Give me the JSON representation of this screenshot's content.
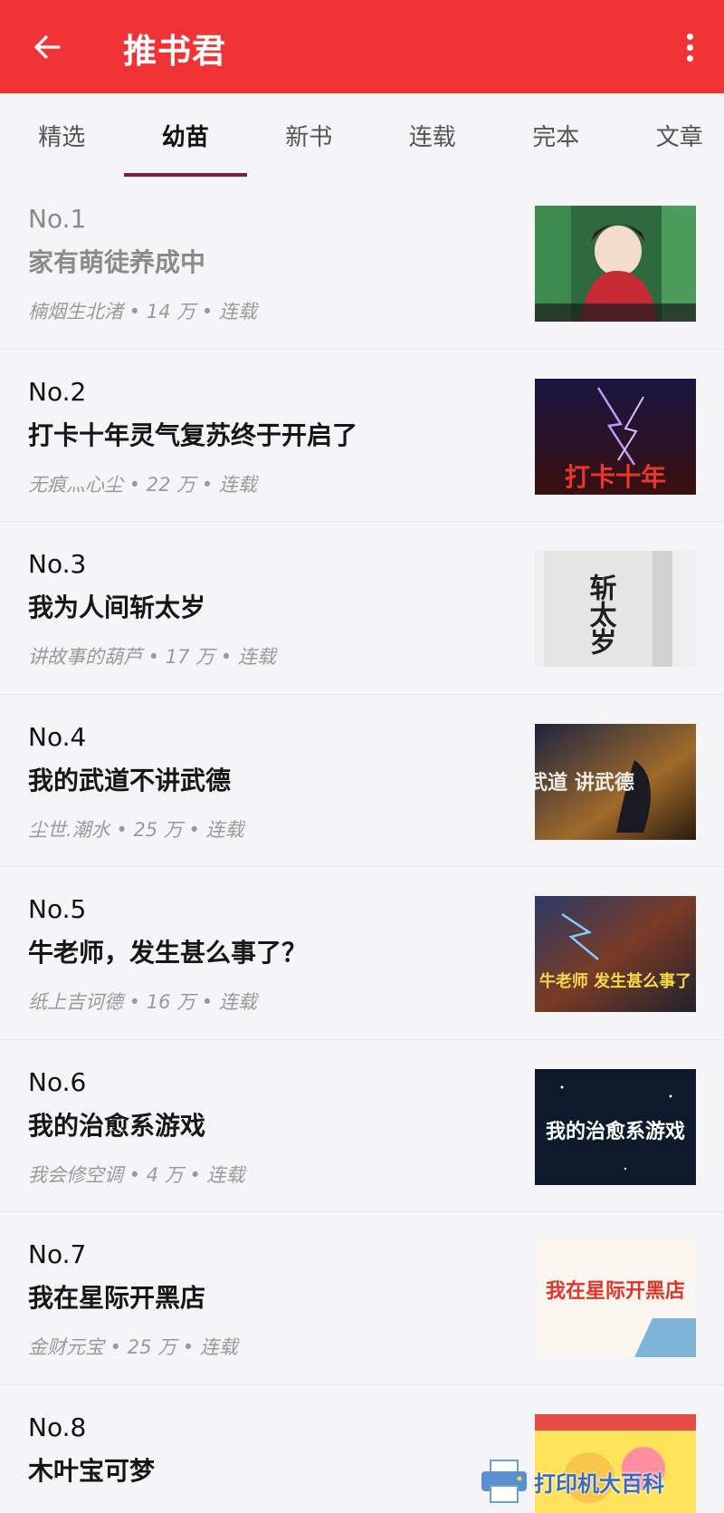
{
  "appbar": {
    "title": "推书君"
  },
  "tabs": [
    {
      "label": "精选",
      "active": false
    },
    {
      "label": "幼苗",
      "active": true
    },
    {
      "label": "新书",
      "active": false
    },
    {
      "label": "连载",
      "active": false
    },
    {
      "label": "完本",
      "active": false
    },
    {
      "label": "文章",
      "active": false
    }
  ],
  "books": [
    {
      "rank": "No.1",
      "title": "家有萌徒养成中",
      "meta": "楠烟生北渚 • 14 万 • 连载",
      "cover_text": ""
    },
    {
      "rank": "No.2",
      "title": "打卡十年灵气复苏终于开启了",
      "meta": "无痕灬心尘 • 22 万 • 连载",
      "cover_text": "打卡十年"
    },
    {
      "rank": "No.3",
      "title": "我为人间斩太岁",
      "meta": "讲故事的葫芦 • 17 万 • 连载",
      "cover_text": "斩太岁"
    },
    {
      "rank": "No.4",
      "title": "我的武道不讲武德",
      "meta": "尘世.潮水 • 25 万 • 连载",
      "cover_text": "的武道 讲武德"
    },
    {
      "rank": "No.5",
      "title": "牛老师，发生甚么事了？",
      "meta": "纸上吉诃德 • 16 万 • 连载",
      "cover_text": "牛老师 发生甚么事了"
    },
    {
      "rank": "No.6",
      "title": "我的治愈系游戏",
      "meta": "我会修空调 • 4 万 • 连载",
      "cover_text": "我的治愈系游戏"
    },
    {
      "rank": "No.7",
      "title": "我在星际开黑店",
      "meta": "金财元宝 • 25 万 • 连载",
      "cover_text": "我在星际开黑店"
    },
    {
      "rank": "No.8",
      "title": "木叶宝可梦",
      "meta": "",
      "cover_text": ""
    }
  ],
  "watermark": {
    "text": "打印机大百科"
  },
  "colors": {
    "appbar": "#f23336",
    "tab_indicator": "#7a1e44"
  }
}
